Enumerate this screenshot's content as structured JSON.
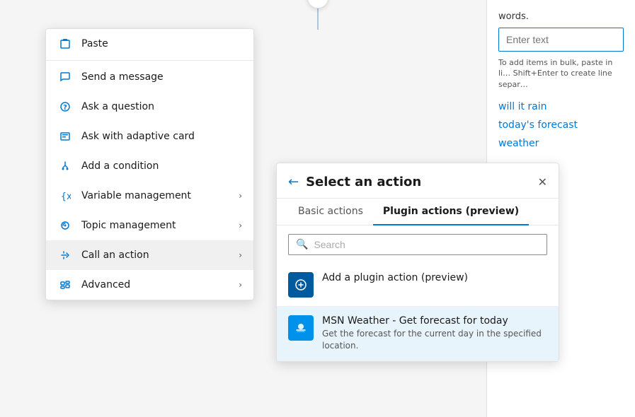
{
  "connector": {
    "visible": true
  },
  "close_button": {
    "label": "✕"
  },
  "context_menu": {
    "items": [
      {
        "id": "paste",
        "label": "Paste",
        "icon": "paste",
        "has_arrow": false
      },
      {
        "id": "send-message",
        "label": "Send a message",
        "icon": "message",
        "has_arrow": false
      },
      {
        "id": "ask-question",
        "label": "Ask a question",
        "icon": "question",
        "has_arrow": false
      },
      {
        "id": "ask-adaptive",
        "label": "Ask with adaptive card",
        "icon": "adaptive",
        "has_arrow": false
      },
      {
        "id": "add-condition",
        "label": "Add a condition",
        "icon": "condition",
        "has_arrow": false
      },
      {
        "id": "variable-management",
        "label": "Variable management",
        "icon": "variable",
        "has_arrow": true
      },
      {
        "id": "topic-management",
        "label": "Topic management",
        "icon": "topic",
        "has_arrow": true
      },
      {
        "id": "call-action",
        "label": "Call an action",
        "icon": "action",
        "has_arrow": true,
        "active": true
      },
      {
        "id": "advanced",
        "label": "Advanced",
        "icon": "advanced",
        "has_arrow": true
      }
    ]
  },
  "action_panel": {
    "title": "Select an action",
    "back_label": "←",
    "close_label": "✕",
    "tabs": [
      {
        "id": "basic",
        "label": "Basic actions",
        "active": false
      },
      {
        "id": "plugin",
        "label": "Plugin actions (preview)",
        "active": true
      }
    ],
    "search": {
      "placeholder": "Search"
    },
    "action_items": [
      {
        "id": "add-plugin",
        "title": "Add a plugin action (preview)",
        "desc": "",
        "icon_type": "plugin"
      },
      {
        "id": "msn-weather",
        "title": "MSN Weather - Get forecast for today",
        "desc": "Get the forecast for the current day in the specified location.",
        "icon_type": "weather"
      }
    ]
  },
  "right_panel": {
    "words_label": "words.",
    "enter_text_placeholder": "Enter text",
    "hint": "To add items in bulk, paste in li… Shift+Enter to create line separ…",
    "tags": [
      "will it rain",
      "today's forecast",
      "weather"
    ]
  }
}
